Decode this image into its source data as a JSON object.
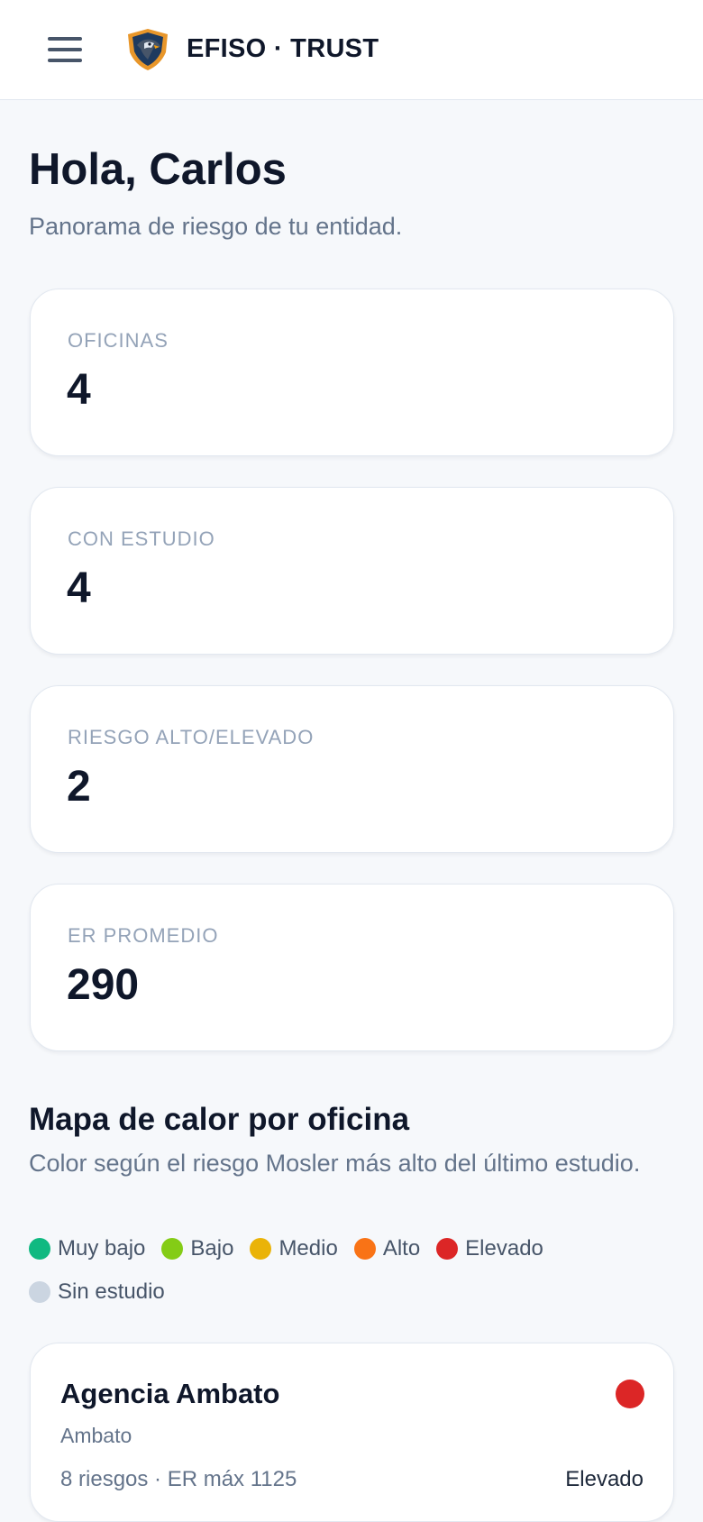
{
  "header": {
    "brand": "EFISO · TRUST",
    "menu_icon": "hamburger-icon",
    "logo_icon": "eagle-shield-logo"
  },
  "greeting": {
    "title": "Hola, Carlos",
    "subtitle": "Panorama de riesgo de tu entidad."
  },
  "stats": [
    {
      "label": "OFICINAS",
      "value": "4"
    },
    {
      "label": "CON ESTUDIO",
      "value": "4"
    },
    {
      "label": "RIESGO ALTO/ELEVADO",
      "value": "2"
    },
    {
      "label": "ER PROMEDIO",
      "value": "290"
    }
  ],
  "heatmap": {
    "title": "Mapa de calor por oficina",
    "description": "Color según el riesgo Mosler más alto del último estudio.",
    "legend": [
      {
        "label": "Muy bajo",
        "color": "#10b981"
      },
      {
        "label": "Bajo",
        "color": "#84cc16"
      },
      {
        "label": "Medio",
        "color": "#eab308"
      },
      {
        "label": "Alto",
        "color": "#f97316"
      },
      {
        "label": "Elevado",
        "color": "#dc2626"
      },
      {
        "label": "Sin estudio",
        "color": "#cbd5e1"
      }
    ],
    "offices": [
      {
        "name": "Agencia Ambato",
        "city": "Ambato",
        "meta": "8 riesgos · ER máx 1125",
        "level": "Elevado",
        "color": "#dc2626"
      }
    ]
  }
}
